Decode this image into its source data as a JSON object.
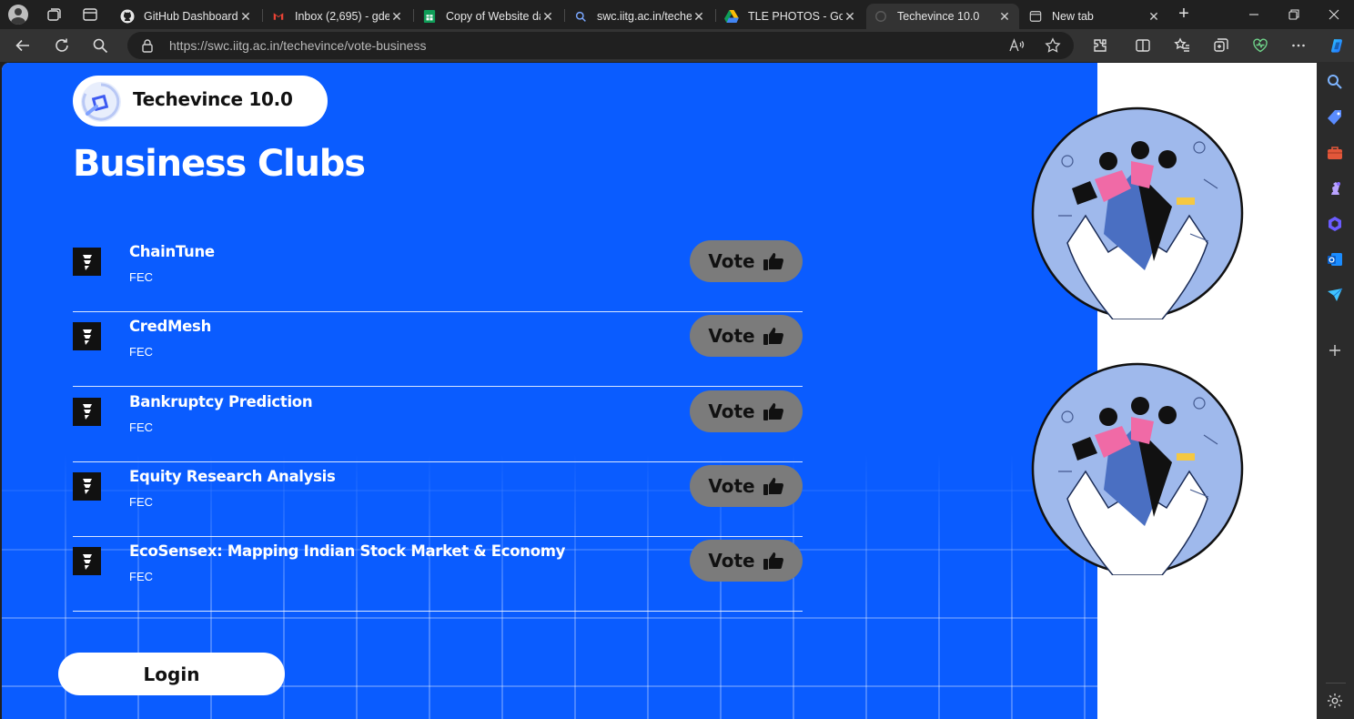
{
  "browser": {
    "tabs": [
      {
        "title": "GitHub Dashboard",
        "favicon": "github-icon"
      },
      {
        "title": "Inbox (2,695) - gdev",
        "favicon": "gmail-icon"
      },
      {
        "title": "Copy of Website dat",
        "favicon": "sheets-icon"
      },
      {
        "title": "swc.iitg.ac.in/techev",
        "favicon": "search-icon"
      },
      {
        "title": "TLE PHOTOS - Goog",
        "favicon": "drive-icon"
      },
      {
        "title": "Techevince 10.0",
        "favicon": "loading-icon",
        "active": true
      },
      {
        "title": "New tab",
        "favicon": "newtab-icon"
      }
    ],
    "url": "https://swc.iitg.ac.in/techevince/vote-business"
  },
  "page": {
    "brand": "Techevince 10.0",
    "title": "Business Clubs",
    "vote_label": "Vote",
    "login_label": "Login",
    "clubs": [
      {
        "name": "ChainTune",
        "org": "FEC"
      },
      {
        "name": "CredMesh",
        "org": "FEC"
      },
      {
        "name": "Bankruptcy Prediction",
        "org": "FEC"
      },
      {
        "name": "Equity Research Analysis",
        "org": "FEC"
      },
      {
        "name": "EcoSensex: Mapping Indian Stock Market & Economy",
        "org": "FEC"
      }
    ]
  },
  "colors": {
    "brand_blue": "#0a5cff",
    "vote_button": "#7b7b7b"
  }
}
